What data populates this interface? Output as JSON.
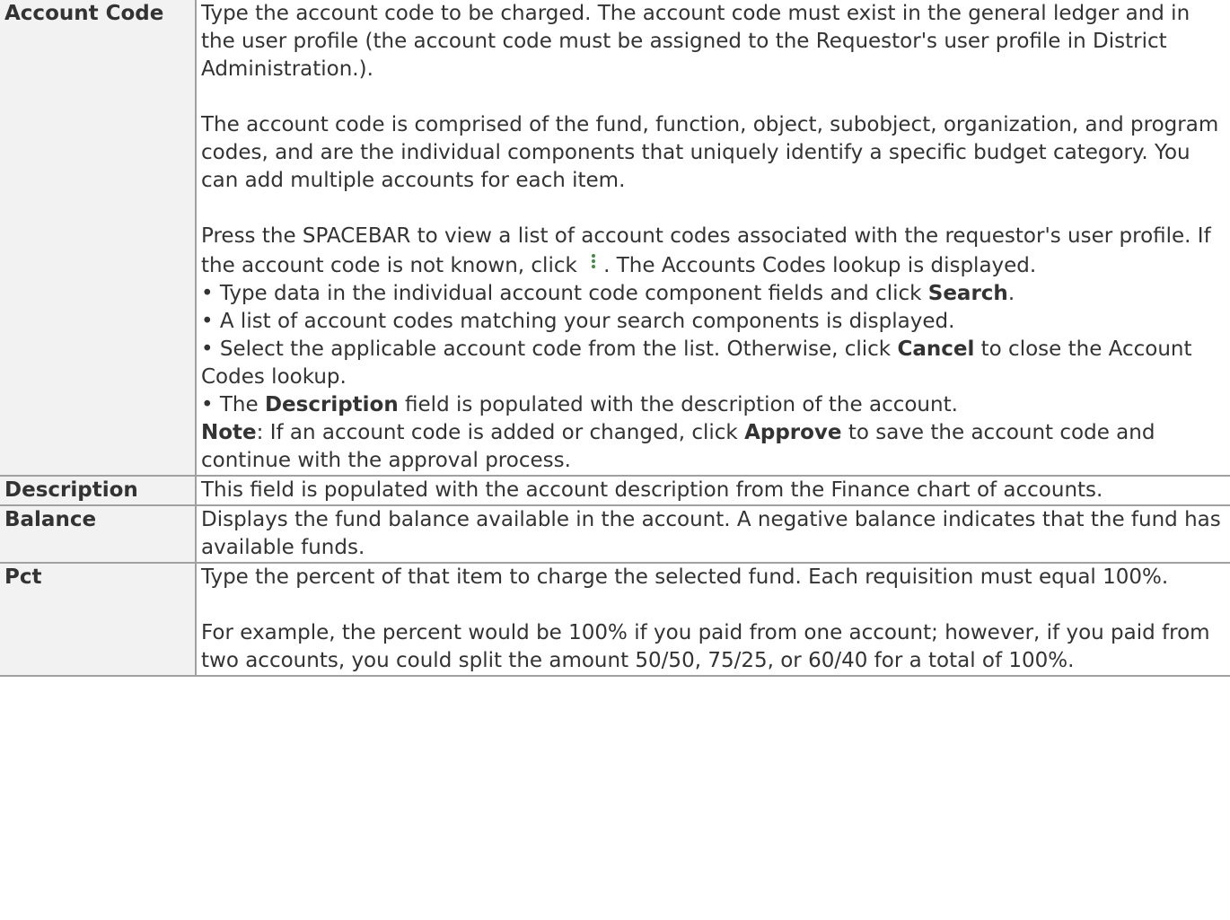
{
  "rows": [
    {
      "label": "Account Code",
      "p1": "Type the account code to be charged. The account code must exist in the general ledger and in the user profile (the account code must be assigned to the Requestor's user profile in District Administration.).",
      "p2": "The account code is comprised of the fund, function, object, subobject, organization, and program codes, and are the individual components that uniquely identify a specific budget category. You can add multiple accounts for each item.",
      "p3_a": "Press the SPACEBAR to view a list of account codes associated with the requestor's user profile. If the account code is not known, click",
      "p3_icon": "kebab-menu-icon",
      "p3_b": ". The Accounts Codes lookup is displayed.",
      "b1_text": "• Type data in the individual account code component fields and click ",
      "b1_bold": "Search",
      "b1_end": ".",
      "b2_text": "• A list of account codes matching your search components is displayed.",
      "b3_text": "• Select the applicable account code from the list. Otherwise, click ",
      "b3_bold": "Cancel",
      "b3_end": " to close the Account Codes lookup.",
      "b4_pre": "• The ",
      "b4_bold": "Description",
      "b4_text": " field is populated with the description of the account.",
      "note_bold": "Note",
      "note_text1": ": If an account code is added or changed, click ",
      "note_bold2": "Approve",
      "note_text2": " to save the account code and continue with the approval process."
    },
    {
      "label": "Description",
      "p1": "This field is populated with the account description from the Finance chart of accounts."
    },
    {
      "label": "Balance",
      "p1": "Displays the fund balance available in the account. A negative balance indicates that the fund has available funds."
    },
    {
      "label": "Pct",
      "p1": "Type the percent of that item to charge the selected fund. Each requisition must equal 100%.",
      "p2": "For example, the percent would be 100% if you paid from one account; however, if you paid from two accounts, you could split the amount 50/50, 75/25, or 60/40 for a total of 100%."
    }
  ]
}
